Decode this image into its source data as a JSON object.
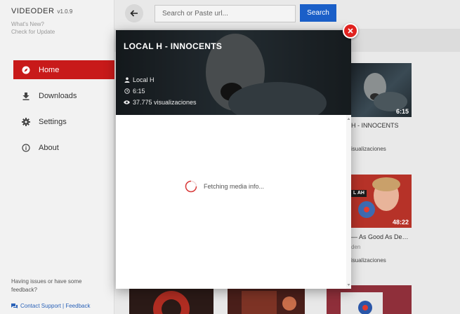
{
  "app": {
    "name": "VIDEODER",
    "version": "v1.0.9",
    "whats_new": "What's New?",
    "check_update": "Check for Update"
  },
  "sidebar": {
    "items": [
      {
        "label": "Home",
        "icon": "compass-icon",
        "active": true
      },
      {
        "label": "Downloads",
        "icon": "download-icon",
        "active": false
      },
      {
        "label": "Settings",
        "icon": "gear-icon",
        "active": false
      },
      {
        "label": "About",
        "icon": "info-icon",
        "active": false
      }
    ],
    "issues_text": "Having issues or have some feedback?",
    "support_link": "Contact Support | Feedback"
  },
  "toolbar": {
    "search_placeholder": "Search or Paste url...",
    "search_label": "Search"
  },
  "grid": {
    "items": [
      {
        "title": "H - INNOCENTS",
        "duration": "6:15",
        "views": "isualizaciones"
      },
      {
        "title": "— As Good As De…",
        "channel": "den",
        "duration": "48:22",
        "views": "isualizaciones",
        "thumb_label": "L AH"
      }
    ]
  },
  "modal": {
    "title": "LOCAL H - INNOCENTS",
    "channel": "Local H",
    "duration": "6:15",
    "views": "37.775 visualizaciones",
    "status": "Fetching media info..."
  },
  "colors": {
    "accent": "#c81a1a",
    "primary": "#1a5fc8",
    "close": "#e0221f"
  }
}
